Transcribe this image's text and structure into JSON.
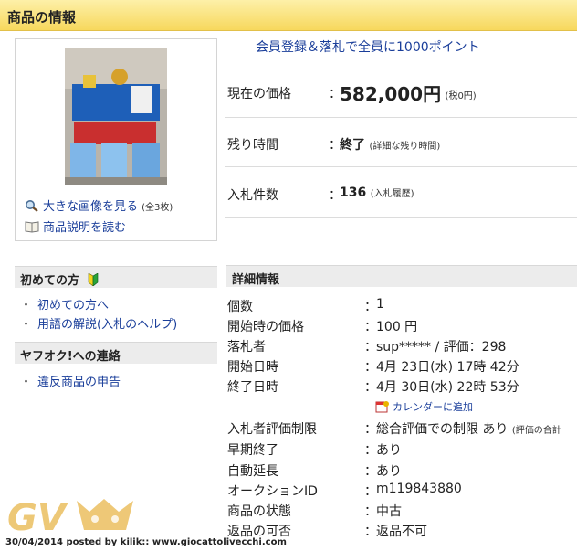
{
  "header": {
    "title": "商品の情報"
  },
  "image_panel": {
    "photo_icon": "product-photo",
    "view_larger": "大きな画像を見る",
    "image_count": "(全3枚)",
    "read_description": "商品説明を読む"
  },
  "promo": "会員登録＆落札で全員に1000ポイント",
  "summary": {
    "price_label": "現在の価格",
    "price_value": "582,000円",
    "tax_note": "(税0円)",
    "time_label": "残り時間",
    "time_value": "終了",
    "time_link": "(詳細な残り時間)",
    "bids_label": "入札件数",
    "bids_value": "136",
    "bids_link": "(入札履歴)",
    "colon": "："
  },
  "sidebar": {
    "beginner_title": "初めての方",
    "beginner_items": [
      "初めての方へ",
      "用語の解説(入札のヘルプ)"
    ],
    "report_title": "ヤフオク!への連絡",
    "report_items": [
      "違反商品の申告"
    ]
  },
  "details": {
    "title": "詳細情報",
    "rows": [
      {
        "label": "個数",
        "value": "1"
      },
      {
        "label": "開始時の価格",
        "value": "100 円"
      },
      {
        "label": "落札者",
        "value": "sup***** / 評価：298"
      },
      {
        "label": "開始日時",
        "value": "4月 23日(水) 17時 42分"
      },
      {
        "label": "終了日時",
        "value": "4月 30日(水) 22時 53分"
      },
      {
        "label": "入札者評価制限",
        "value": "総合評価での制限 あり",
        "note": "(評価の合計"
      },
      {
        "label": "早期終了",
        "value": "あり"
      },
      {
        "label": "自動延長",
        "value": "あり"
      },
      {
        "label": "オークションID",
        "value": "m119843880"
      },
      {
        "label": "商品の状態",
        "value": "中古"
      },
      {
        "label": "返品の可否",
        "value": "返品不可"
      }
    ],
    "calendar_link": "カレンダーに追加",
    "colon": "："
  },
  "watermark": {
    "logo_text": "GV"
  },
  "credit": "30/04/2014 posted by kilik:: www.giocattolivecchi.com",
  "colors": {
    "header_bg": "#f7d85d",
    "link": "#1a3e9a",
    "section_bg": "#ececec"
  }
}
